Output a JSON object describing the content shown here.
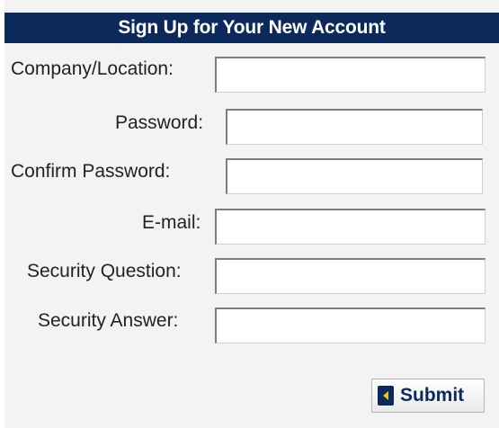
{
  "form": {
    "title": "Sign Up for Your New Account",
    "fields": [
      {
        "label": "Company/Location:",
        "value": "",
        "placeholder": ""
      },
      {
        "label": "Password:",
        "value": "",
        "placeholder": ""
      },
      {
        "label": "Confirm Password:",
        "value": "",
        "placeholder": ""
      },
      {
        "label": "E-mail:",
        "value": "",
        "placeholder": ""
      },
      {
        "label": "Security Question:",
        "value": "",
        "placeholder": ""
      },
      {
        "label": "Security Answer:",
        "value": "",
        "placeholder": ""
      }
    ],
    "submit_label": "Submit",
    "submit_icon": "chevron-left-icon"
  },
  "colors": {
    "header_bg": "#0b2a5b",
    "header_text": "#ffffff",
    "panel_bg": "#f3f3f3",
    "accent": "#0b2a5b"
  }
}
